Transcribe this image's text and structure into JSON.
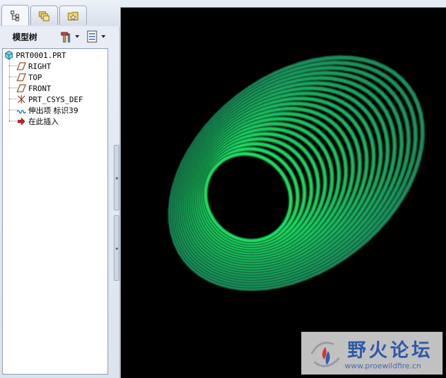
{
  "panel": {
    "tabs": [
      {
        "icon": "model-tree-icon",
        "active": true
      },
      {
        "icon": "folder-browser-icon",
        "active": false
      },
      {
        "icon": "favorites-folder-icon",
        "active": false
      }
    ],
    "title": "模型树",
    "tools": [
      {
        "icon": "settings-hammer-icon",
        "has_dropdown": true
      },
      {
        "icon": "show-list-icon",
        "has_dropdown": true
      }
    ]
  },
  "tree": {
    "items": [
      {
        "label": "PRT0001.PRT",
        "icon": "part-icon"
      },
      {
        "label": "RIGHT",
        "icon": "datum-plane-icon"
      },
      {
        "label": "TOP",
        "icon": "datum-plane-icon"
      },
      {
        "label": "FRONT",
        "icon": "datum-plane-icon"
      },
      {
        "label": "PRT_CSYS_DEF",
        "icon": "coordinate-system-icon"
      },
      {
        "label": "伸出项 标识39",
        "icon": "protrusion-icon"
      },
      {
        "label": "在此插入",
        "icon": "insert-here-arrow-icon"
      }
    ]
  },
  "viewport": {
    "background": "#000000",
    "model_color": "#1fc56a",
    "model": "spiral-sweep-protrusion"
  },
  "watermark": {
    "title": "野火论坛",
    "url": "www.proewildfire.cn",
    "color": "#2e5aa6"
  }
}
